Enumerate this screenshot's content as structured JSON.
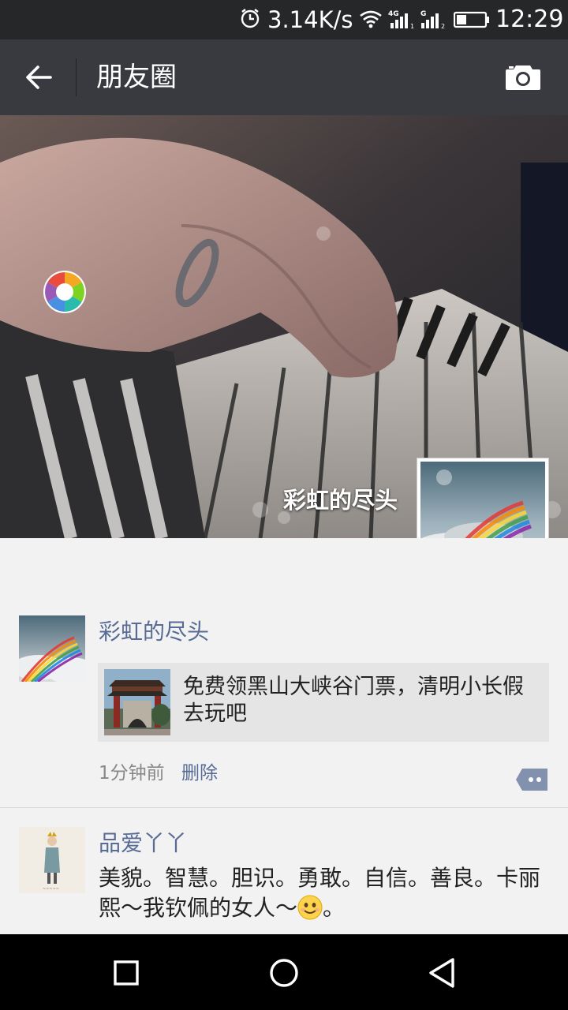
{
  "status_bar": {
    "network_speed": "3.14K/s",
    "time": "12:29",
    "icons": [
      "alarm-icon",
      "wifi-icon",
      "signal-4g-icon",
      "signal-g-icon",
      "battery-icon"
    ]
  },
  "title_bar": {
    "title": "朋友圈",
    "back_icon": "arrow-left-icon",
    "camera_icon": "camera-icon"
  },
  "cover": {
    "username": "彩虹的尽头"
  },
  "posts": [
    {
      "name": "彩虹的尽头",
      "share_title": "免费领黑山大峡谷门票，清明小长假去玩吧",
      "time": "1分钟前",
      "delete_label": "删除"
    },
    {
      "name": "品爱丫丫",
      "text": "美貌。智慧。胆识。勇敢。自信。善良。卡丽熙～我钦佩的女人～",
      "text_end": "。"
    }
  ],
  "nav": {
    "icons": [
      "square-icon",
      "circle-icon",
      "triangle-back-icon"
    ]
  },
  "colors": {
    "status_bar": "#252729",
    "title_bar": "#393a3f",
    "link_blue": "#576b95",
    "feed_bg": "#f2f2f2"
  }
}
